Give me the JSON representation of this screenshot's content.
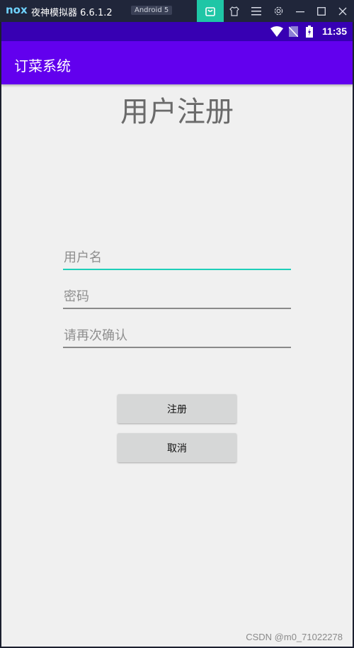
{
  "emulator": {
    "logo": "nox",
    "title": "夜神模拟器 6.6.1.2",
    "badge": "Android 5",
    "buttons": [
      "store-icon",
      "skin-icon",
      "menu-icon",
      "settings-icon",
      "minimize-icon",
      "maximize-icon",
      "close-icon"
    ]
  },
  "status_bar": {
    "time": "11:35",
    "icons": [
      "wifi-icon",
      "no-sim-icon",
      "battery-icon"
    ]
  },
  "app_bar": {
    "title": "订菜系统"
  },
  "page": {
    "heading": "用户注册",
    "fields": {
      "username_placeholder": "用户名",
      "password_placeholder": "密码",
      "confirm_placeholder": "请再次确认"
    },
    "buttons": {
      "register": "注册",
      "cancel": "取消"
    }
  },
  "watermark": "CSDN @m0_71022278",
  "colors": {
    "status_bar": "#3700b3",
    "app_bar": "#6200ee",
    "focus_underline": "#1dcfb8",
    "background": "#f0f0f0"
  }
}
